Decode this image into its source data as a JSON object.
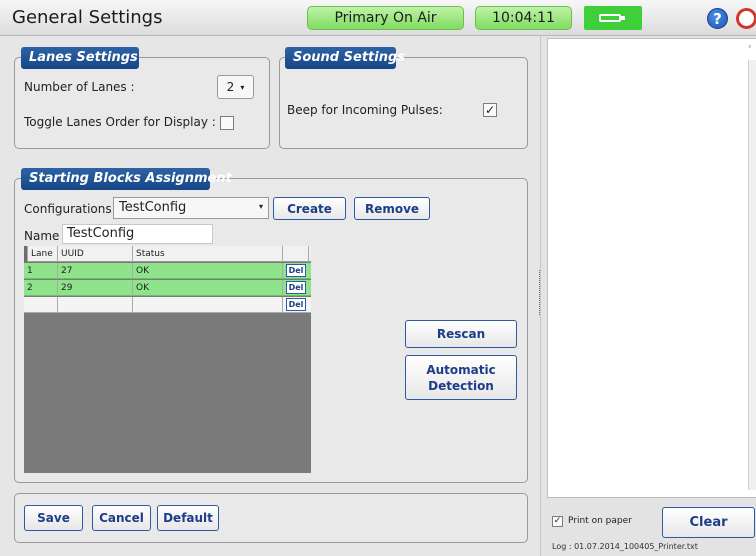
{
  "app": {
    "title": "General Settings",
    "on_air": "Primary On Air",
    "clock": "10:04:11",
    "help_glyph": "?",
    "colors": {
      "accent": "#1f4f94",
      "status_green": "#8fe38a",
      "battery_green": "#3fcf3a",
      "power_red": "#d3342c"
    }
  },
  "lanes": {
    "legend": "Lanes Settings",
    "num_lanes_label": "Number of Lanes :",
    "num_lanes_value": "2",
    "toggle_label": "Toggle Lanes Order for Display :",
    "toggle_checked": false
  },
  "sound": {
    "legend": "Sound Settings",
    "beep_label": "Beep for Incoming Pulses:",
    "beep_checked": true,
    "check_glyph": "✓"
  },
  "blocks": {
    "legend": "Starting Blocks Assignment",
    "config_label": "Configurations :",
    "config_value": "TestConfig",
    "create_label": "Create",
    "remove_label": "Remove",
    "name_label": "Name :",
    "name_value": "TestConfig",
    "columns": [
      "Lane",
      "UUID",
      "Status"
    ],
    "rows": [
      {
        "lane": "1",
        "uuid": "27",
        "status": "OK",
        "del": "Del"
      },
      {
        "lane": "2",
        "uuid": "29",
        "status": "OK",
        "del": "Del"
      },
      {
        "lane": "",
        "uuid": "",
        "status": "",
        "del": "Del"
      }
    ],
    "rescan_label": "Rescan",
    "auto_label_line1": "Automatic",
    "auto_label_line2": "Detection"
  },
  "footer": {
    "save": "Save",
    "cancel": "Cancel",
    "default": "Default"
  },
  "log": {
    "print_label": "Print on paper",
    "print_checked": true,
    "clear_label": "Clear",
    "filename": "Log : 01.07.2014_100405_Printer.txt"
  }
}
